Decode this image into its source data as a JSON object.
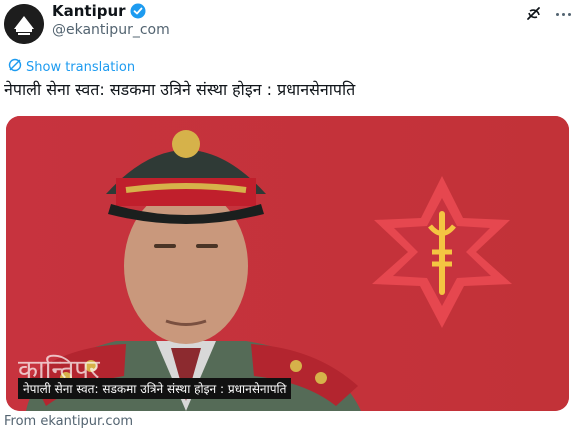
{
  "author": {
    "display_name": "Kantipur",
    "handle": "@ekantipur_com",
    "verified_icon": "verified-badge-icon",
    "brand_color": "#1d9bf0"
  },
  "actions": {
    "grok_icon": "grok-icon",
    "more_icon": "more-options-icon"
  },
  "translation": {
    "label": "Show translation",
    "icon": "translate-icon"
  },
  "tweet": {
    "text": "नेपाली सेना स्वत: सडकमा उत्रिने संस्था होइन : प्रधानसेनापति"
  },
  "media": {
    "caption": "नेपाली सेना स्वत: सडकमा उत्रिने संस्था होइन : प्रधानसेनापति",
    "background_color": "#c7333e"
  },
  "card_source": "From ekantipur.com"
}
